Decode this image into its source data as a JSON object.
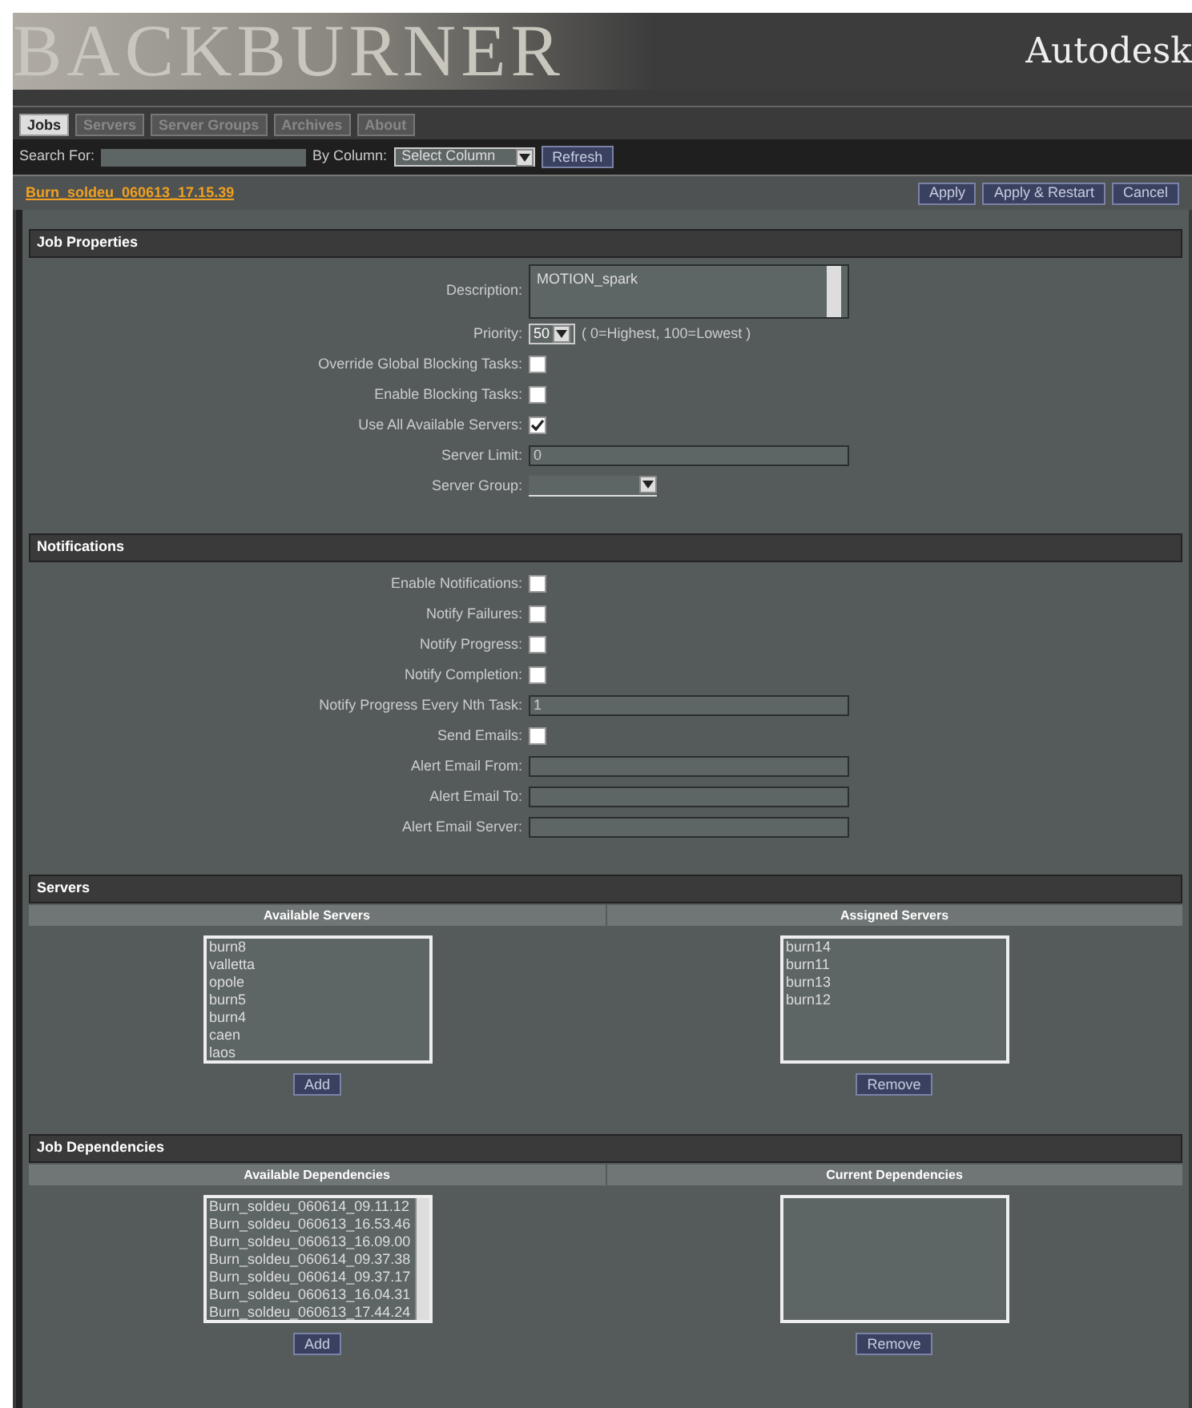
{
  "header": {
    "logo": "BACKBURNER",
    "brand": "Autodesk"
  },
  "tabs": [
    {
      "label": "Jobs",
      "selected": true
    },
    {
      "label": "Servers",
      "selected": false
    },
    {
      "label": "Server Groups",
      "selected": false
    },
    {
      "label": "Archives",
      "selected": false
    },
    {
      "label": "About",
      "selected": false
    }
  ],
  "search": {
    "label": "Search For:",
    "column_label": "By Column:",
    "column_value": "Select Column",
    "refresh": "Refresh"
  },
  "job": {
    "title": "Burn_soldeu_060613_17.15.39",
    "buttons": [
      "Apply",
      "Apply & Restart",
      "Cancel"
    ]
  },
  "sections": [
    {
      "title": "Job Properties",
      "fields": [
        {
          "kind": "textarea",
          "label": "Description:",
          "value": "MOTION_spark"
        },
        {
          "kind": "priority",
          "label": "Priority:",
          "value": "50",
          "hint": "( 0=Highest, 100=Lowest )"
        },
        {
          "kind": "checkbox",
          "label": "Override Global Blocking Tasks:",
          "checked": false
        },
        {
          "kind": "checkbox",
          "label": "Enable Blocking Tasks:",
          "checked": false
        },
        {
          "kind": "checkbox",
          "label": "Use All Available Servers:",
          "checked": true
        },
        {
          "kind": "text",
          "label": "Server Limit:",
          "value": "0"
        },
        {
          "kind": "select",
          "label": "Server Group:"
        }
      ]
    },
    {
      "title": "Notifications",
      "fields": [
        {
          "kind": "checkbox",
          "label": "Enable Notifications:",
          "checked": false
        },
        {
          "kind": "checkbox",
          "label": "Notify Failures:",
          "checked": false
        },
        {
          "kind": "checkbox",
          "label": "Notify Progress:",
          "checked": false
        },
        {
          "kind": "checkbox",
          "label": "Notify Completion:",
          "checked": false
        },
        {
          "kind": "text",
          "label": "Notify Progress Every Nth Task:",
          "value": "1"
        },
        {
          "kind": "checkbox",
          "label": "Send Emails:",
          "checked": false
        },
        {
          "kind": "text",
          "label": "Alert Email From:"
        },
        {
          "kind": "text",
          "label": "Alert Email To:"
        },
        {
          "kind": "text",
          "label": "Alert Email Server:"
        }
      ]
    }
  ],
  "servers": {
    "title": "Servers",
    "available_title": "Available Servers",
    "assigned_title": "Assigned Servers",
    "available": [
      "burn8",
      "valletta",
      "opole",
      "burn5",
      "burn4",
      "caen",
      "laos"
    ],
    "assigned": [
      "burn14",
      "burn11",
      "burn13",
      "burn12"
    ],
    "add": "Add",
    "remove": "Remove"
  },
  "dependencies": {
    "title": "Job Dependencies",
    "available_title": "Available Dependencies",
    "current_title": "Current Dependencies",
    "available": [
      "Burn_soldeu_060614_09.11.12",
      "Burn_soldeu_060613_16.53.46",
      "Burn_soldeu_060613_16.09.00",
      "Burn_soldeu_060614_09.37.38",
      "Burn_soldeu_060614_09.37.17",
      "Burn_soldeu_060613_16.04.31",
      "Burn_soldeu_060613_17.44.24"
    ],
    "add": "Add",
    "remove": "Remove"
  }
}
